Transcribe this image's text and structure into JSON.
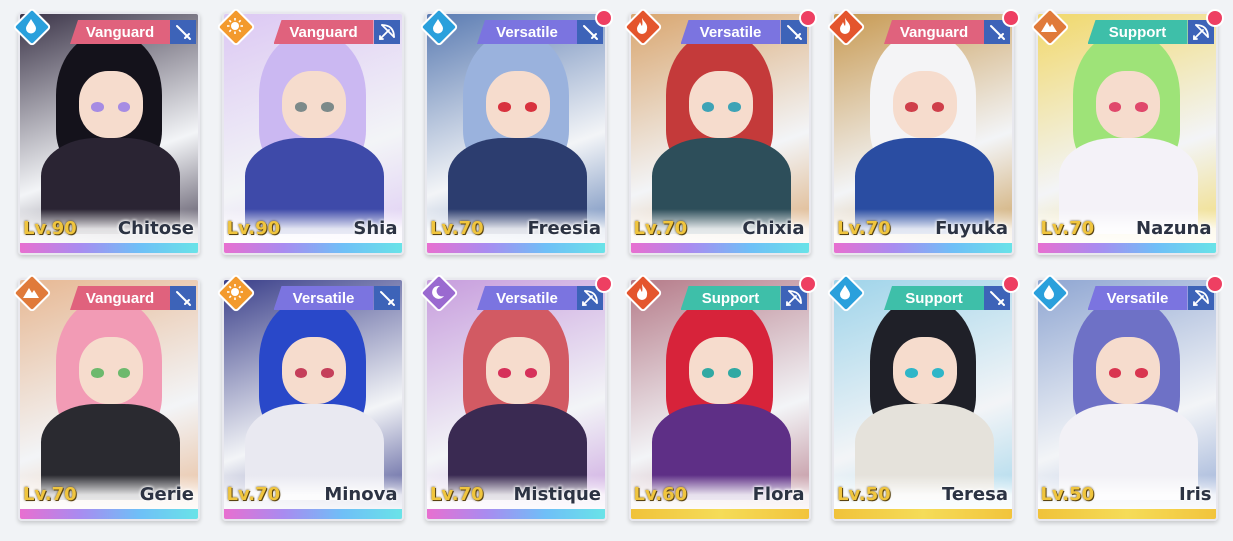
{
  "roster": [
    {
      "name": "Chitose",
      "level": "Lv.90",
      "role": "Vanguard",
      "element": "water",
      "weapon": "sword",
      "notification": false,
      "rarity": "rainbow",
      "colors": {
        "bg": "#3b3448",
        "hair": "#14121b",
        "body": "#2a2433",
        "eye": "#a68ce3"
      }
    },
    {
      "name": "Shia",
      "level": "Lv.90",
      "role": "Vanguard",
      "element": "light",
      "weapon": "bow",
      "notification": false,
      "rarity": "rainbow",
      "colors": {
        "bg": "#dcc8f3",
        "hair": "#cbb8f2",
        "body": "#3e4aa9",
        "eye": "#7c8a8a"
      }
    },
    {
      "name": "Freesia",
      "level": "Lv.70",
      "role": "Versatile",
      "element": "water",
      "weapon": "sword",
      "notification": true,
      "rarity": "rainbow",
      "colors": {
        "bg": "#5a7bb2",
        "hair": "#9ab2dd",
        "body": "#2c3d6f",
        "eye": "#d8323e"
      }
    },
    {
      "name": "Chixia",
      "level": "Lv.70",
      "role": "Versatile",
      "element": "fire",
      "weapon": "sword",
      "notification": true,
      "rarity": "rainbow",
      "colors": {
        "bg": "#d9a66f",
        "hair": "#c43a3a",
        "body": "#2d4e5a",
        "eye": "#3ea3b6"
      }
    },
    {
      "name": "Fuyuka",
      "level": "Lv.70",
      "role": "Vanguard",
      "element": "fire",
      "weapon": "sword",
      "notification": true,
      "rarity": "rainbow",
      "colors": {
        "bg": "#c89a52",
        "hair": "#f4f4f6",
        "body": "#2a4da2",
        "eye": "#cf3f4a"
      }
    },
    {
      "name": "Nazuna",
      "level": "Lv.70",
      "role": "Support",
      "element": "earth",
      "weapon": "bow",
      "notification": true,
      "rarity": "rainbow",
      "colors": {
        "bg": "#f1d86a",
        "hair": "#9ee378",
        "body": "#f4f2f8",
        "eye": "#e0486b"
      }
    },
    {
      "name": "Gerie",
      "level": "Lv.70",
      "role": "Vanguard",
      "element": "earth",
      "weapon": "sword",
      "notification": false,
      "rarity": "rainbow",
      "colors": {
        "bg": "#e7b893",
        "hair": "#f29bb5",
        "body": "#2a2a30",
        "eye": "#6db96d"
      }
    },
    {
      "name": "Minova",
      "level": "Lv.70",
      "role": "Versatile",
      "element": "light",
      "weapon": "sword",
      "notification": false,
      "rarity": "rainbow",
      "colors": {
        "bg": "#3a3f8a",
        "hair": "#2948c9",
        "body": "#e9e9f1",
        "eye": "#c53f5a"
      }
    },
    {
      "name": "Mistique",
      "level": "Lv.70",
      "role": "Versatile",
      "element": "dark",
      "weapon": "bow",
      "notification": true,
      "rarity": "rainbow",
      "colors": {
        "bg": "#c79ddd",
        "hair": "#d25a63",
        "body": "#3a2a52",
        "eye": "#d6315a"
      }
    },
    {
      "name": "Flora",
      "level": "Lv.60",
      "role": "Support",
      "element": "fire",
      "weapon": "bow",
      "notification": true,
      "rarity": "gold",
      "colors": {
        "bg": "#b57b89",
        "hair": "#d7233a",
        "body": "#5e2f86",
        "eye": "#31a9a3"
      }
    },
    {
      "name": "Teresa",
      "level": "Lv.50",
      "role": "Support",
      "element": "water",
      "weapon": "sword",
      "notification": true,
      "rarity": "gold",
      "colors": {
        "bg": "#9fd4ea",
        "hair": "#1f2028",
        "body": "#e5e2db",
        "eye": "#2fb6c8"
      }
    },
    {
      "name": "Iris",
      "level": "Lv.50",
      "role": "Versatile",
      "element": "water",
      "weapon": "bow",
      "notification": true,
      "rarity": "gold",
      "colors": {
        "bg": "#8fa6d2",
        "hair": "#6e71c6",
        "body": "#f2f1f6",
        "eye": "#d93650"
      }
    }
  ],
  "element_colors": {
    "water": "#2aa0dc",
    "light": "#f39a2d",
    "fire": "#e4552d",
    "earth": "#e07a3a",
    "dark": "#9a6ad0"
  }
}
